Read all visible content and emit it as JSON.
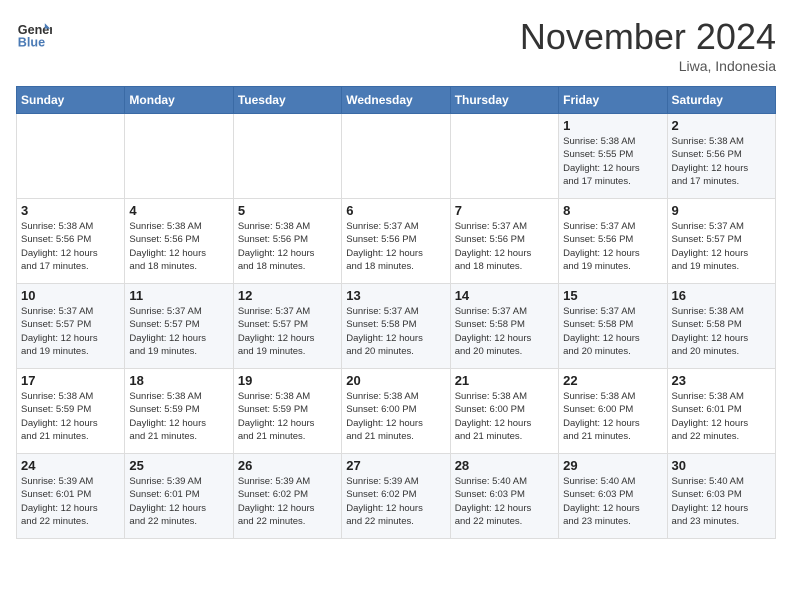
{
  "header": {
    "logo_line1": "General",
    "logo_line2": "Blue",
    "month": "November 2024",
    "location": "Liwa, Indonesia"
  },
  "days_of_week": [
    "Sunday",
    "Monday",
    "Tuesday",
    "Wednesday",
    "Thursday",
    "Friday",
    "Saturday"
  ],
  "weeks": [
    [
      {
        "day": "",
        "info": ""
      },
      {
        "day": "",
        "info": ""
      },
      {
        "day": "",
        "info": ""
      },
      {
        "day": "",
        "info": ""
      },
      {
        "day": "",
        "info": ""
      },
      {
        "day": "1",
        "info": "Sunrise: 5:38 AM\nSunset: 5:55 PM\nDaylight: 12 hours\nand 17 minutes."
      },
      {
        "day": "2",
        "info": "Sunrise: 5:38 AM\nSunset: 5:56 PM\nDaylight: 12 hours\nand 17 minutes."
      }
    ],
    [
      {
        "day": "3",
        "info": "Sunrise: 5:38 AM\nSunset: 5:56 PM\nDaylight: 12 hours\nand 17 minutes."
      },
      {
        "day": "4",
        "info": "Sunrise: 5:38 AM\nSunset: 5:56 PM\nDaylight: 12 hours\nand 18 minutes."
      },
      {
        "day": "5",
        "info": "Sunrise: 5:38 AM\nSunset: 5:56 PM\nDaylight: 12 hours\nand 18 minutes."
      },
      {
        "day": "6",
        "info": "Sunrise: 5:37 AM\nSunset: 5:56 PM\nDaylight: 12 hours\nand 18 minutes."
      },
      {
        "day": "7",
        "info": "Sunrise: 5:37 AM\nSunset: 5:56 PM\nDaylight: 12 hours\nand 18 minutes."
      },
      {
        "day": "8",
        "info": "Sunrise: 5:37 AM\nSunset: 5:56 PM\nDaylight: 12 hours\nand 19 minutes."
      },
      {
        "day": "9",
        "info": "Sunrise: 5:37 AM\nSunset: 5:57 PM\nDaylight: 12 hours\nand 19 minutes."
      }
    ],
    [
      {
        "day": "10",
        "info": "Sunrise: 5:37 AM\nSunset: 5:57 PM\nDaylight: 12 hours\nand 19 minutes."
      },
      {
        "day": "11",
        "info": "Sunrise: 5:37 AM\nSunset: 5:57 PM\nDaylight: 12 hours\nand 19 minutes."
      },
      {
        "day": "12",
        "info": "Sunrise: 5:37 AM\nSunset: 5:57 PM\nDaylight: 12 hours\nand 19 minutes."
      },
      {
        "day": "13",
        "info": "Sunrise: 5:37 AM\nSunset: 5:58 PM\nDaylight: 12 hours\nand 20 minutes."
      },
      {
        "day": "14",
        "info": "Sunrise: 5:37 AM\nSunset: 5:58 PM\nDaylight: 12 hours\nand 20 minutes."
      },
      {
        "day": "15",
        "info": "Sunrise: 5:37 AM\nSunset: 5:58 PM\nDaylight: 12 hours\nand 20 minutes."
      },
      {
        "day": "16",
        "info": "Sunrise: 5:38 AM\nSunset: 5:58 PM\nDaylight: 12 hours\nand 20 minutes."
      }
    ],
    [
      {
        "day": "17",
        "info": "Sunrise: 5:38 AM\nSunset: 5:59 PM\nDaylight: 12 hours\nand 21 minutes."
      },
      {
        "day": "18",
        "info": "Sunrise: 5:38 AM\nSunset: 5:59 PM\nDaylight: 12 hours\nand 21 minutes."
      },
      {
        "day": "19",
        "info": "Sunrise: 5:38 AM\nSunset: 5:59 PM\nDaylight: 12 hours\nand 21 minutes."
      },
      {
        "day": "20",
        "info": "Sunrise: 5:38 AM\nSunset: 6:00 PM\nDaylight: 12 hours\nand 21 minutes."
      },
      {
        "day": "21",
        "info": "Sunrise: 5:38 AM\nSunset: 6:00 PM\nDaylight: 12 hours\nand 21 minutes."
      },
      {
        "day": "22",
        "info": "Sunrise: 5:38 AM\nSunset: 6:00 PM\nDaylight: 12 hours\nand 21 minutes."
      },
      {
        "day": "23",
        "info": "Sunrise: 5:38 AM\nSunset: 6:01 PM\nDaylight: 12 hours\nand 22 minutes."
      }
    ],
    [
      {
        "day": "24",
        "info": "Sunrise: 5:39 AM\nSunset: 6:01 PM\nDaylight: 12 hours\nand 22 minutes."
      },
      {
        "day": "25",
        "info": "Sunrise: 5:39 AM\nSunset: 6:01 PM\nDaylight: 12 hours\nand 22 minutes."
      },
      {
        "day": "26",
        "info": "Sunrise: 5:39 AM\nSunset: 6:02 PM\nDaylight: 12 hours\nand 22 minutes."
      },
      {
        "day": "27",
        "info": "Sunrise: 5:39 AM\nSunset: 6:02 PM\nDaylight: 12 hours\nand 22 minutes."
      },
      {
        "day": "28",
        "info": "Sunrise: 5:40 AM\nSunset: 6:03 PM\nDaylight: 12 hours\nand 22 minutes."
      },
      {
        "day": "29",
        "info": "Sunrise: 5:40 AM\nSunset: 6:03 PM\nDaylight: 12 hours\nand 23 minutes."
      },
      {
        "day": "30",
        "info": "Sunrise: 5:40 AM\nSunset: 6:03 PM\nDaylight: 12 hours\nand 23 minutes."
      }
    ]
  ]
}
